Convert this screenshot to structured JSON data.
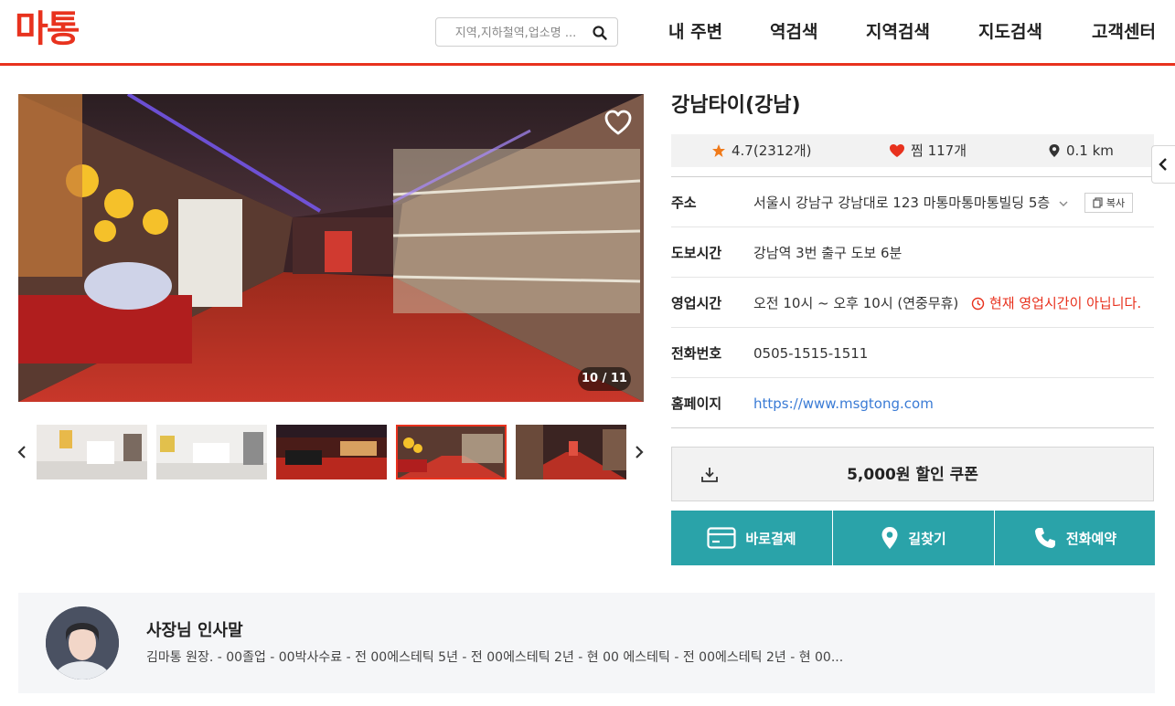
{
  "header": {
    "logo_text": "마통",
    "search": {
      "placeholder": "지역,지하철역,업소명 ..."
    },
    "nav": [
      "내 주변",
      "역검색",
      "지역검색",
      "지도검색",
      "고객센터"
    ]
  },
  "gallery": {
    "counter": "10 / 11",
    "current": 10,
    "total": 11,
    "thumbnails": [
      "thumb-1",
      "thumb-2",
      "thumb-3",
      "thumb-4",
      "thumb-5"
    ],
    "active_thumbnail": 4
  },
  "shop": {
    "title": "강남타이(강남)",
    "rating": "4.7(2312개)",
    "likes": "찜 117개",
    "distance": "0.1 km",
    "details": {
      "address_label": "주소",
      "address_value": "서울시 강남구 강남대로 123 마통마통마통빌딩 5층",
      "copy_label": "복사",
      "walk_label": "도보시간",
      "walk_value": "강남역 3번 출구 도보 6분",
      "hours_label": "영업시간",
      "hours_value": "오전 10시 ~ 오후 10시 (연중무휴)",
      "hours_status": "현재 영업시간이 아닙니다.",
      "phone_label": "전화번호",
      "phone_value": "0505-1515-1511",
      "homepage_label": "홈페이지",
      "homepage_value": "https://www.msgtong.com"
    }
  },
  "coupon": {
    "label": "5,000원 할인 쿠폰"
  },
  "actions": {
    "pay": "바로결제",
    "directions": "길찾기",
    "call": "전화예약"
  },
  "greeting": {
    "title": "사장님 인사말",
    "text": "김마통 원장. - 00졸업 - 00박사수료 - 전 00에스테틱 5년 - 전 00에스테틱 2년 - 현 00 에스테틱 - 전 00에스테틱 2년 - 현 00..."
  },
  "colors": {
    "brand_red": "#e8321e",
    "action_teal": "#2aa3a9",
    "link_blue": "#3a7bd5",
    "star_orange": "#f07a1a"
  }
}
